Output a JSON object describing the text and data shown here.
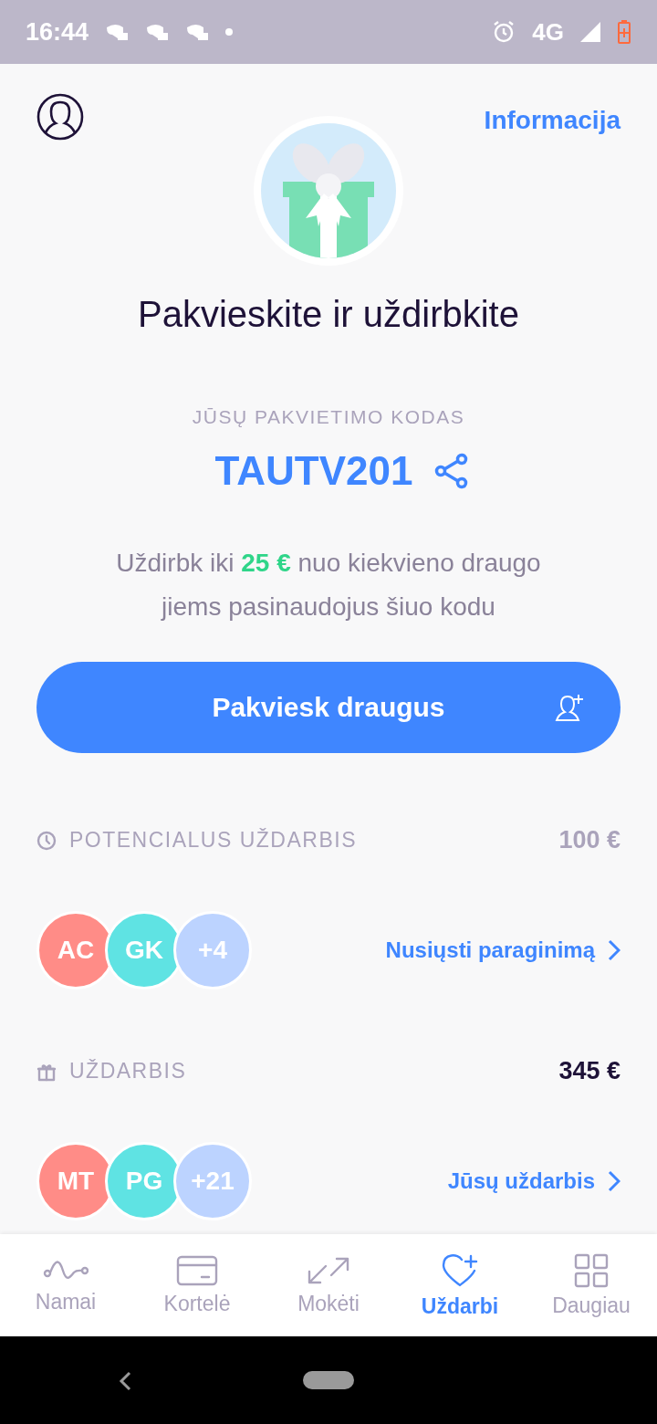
{
  "status_bar": {
    "time": "16:44",
    "network": "4G"
  },
  "header": {
    "link": "Informacija"
  },
  "title": "Pakvieskite ir uždirbkite",
  "code_label": "JŪSŲ PAKVIETIMO KODAS",
  "code": "TAUTV201",
  "description": "Uždirbk iki **25 €** nuo kiekvieno draugo jiems pasinaudojus šiuo kodu",
  "invite_button": "Pakviesk draugus",
  "sections": [
    {
      "kind": "pending",
      "label": "POTENCIALUS UŽDARBIS",
      "amount": "100 €",
      "link": "Nusiųsti paraginimą",
      "avatars": [
        {
          "text": "AC",
          "color": "#ff8c87"
        },
        {
          "text": "GK",
          "color": "#5fe3e3"
        },
        {
          "text": "+4",
          "color": "#bcd3ff"
        }
      ]
    },
    {
      "kind": "earned",
      "label": "UŽDARBIS",
      "amount": "345 €",
      "link": "Jūsų uždarbis",
      "avatars": [
        {
          "text": "MT",
          "color": "#ff8c87"
        },
        {
          "text": "PG",
          "color": "#5fe3e3"
        },
        {
          "text": "+21",
          "color": "#bcd3ff"
        }
      ]
    }
  ],
  "tabs": [
    {
      "kind": "home",
      "label": "Namai",
      "selected": false
    },
    {
      "kind": "card",
      "label": "Kortelė",
      "selected": false
    },
    {
      "kind": "pay",
      "label": "Mokėti",
      "selected": false
    },
    {
      "kind": "earn",
      "label": "Uždarbi",
      "selected": true
    },
    {
      "kind": "more",
      "label": "Daugiau",
      "selected": false
    }
  ]
}
